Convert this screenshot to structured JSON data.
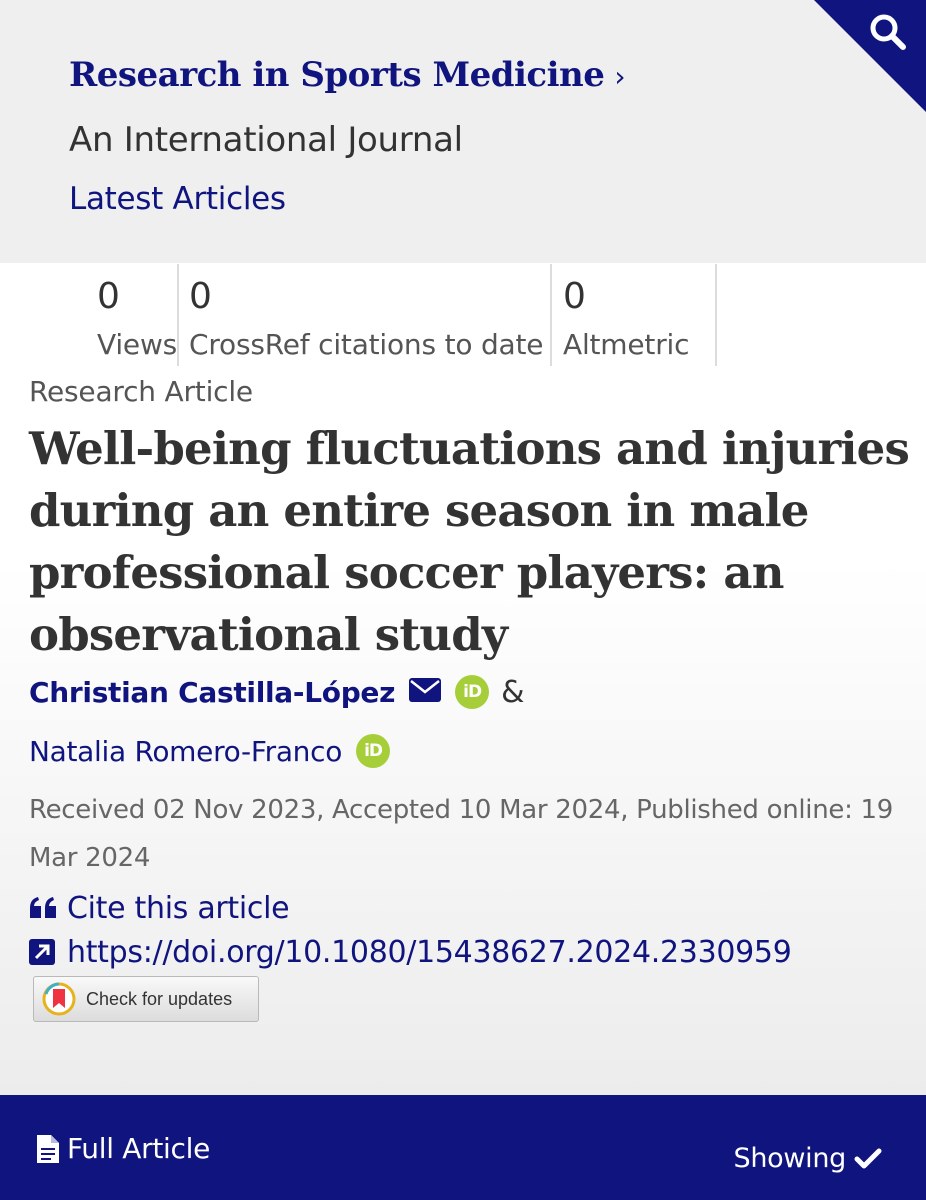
{
  "header": {
    "journal_title": "Research in Sports Medicine",
    "journal_subtitle": "An International Journal",
    "latest_link": "Latest Articles",
    "chevron": "›"
  },
  "metrics": [
    {
      "value": "0",
      "label": "Views"
    },
    {
      "value": "0",
      "label": "CrossRef citations to date"
    },
    {
      "value": "0",
      "label": "Altmetric"
    }
  ],
  "article": {
    "type": "Research Article",
    "title": "Well-being fluctuations and injuries during an entire season in male professional soccer players: an observational study",
    "authors": [
      {
        "name": "Christian Castilla-López",
        "orcid_badge": "iD"
      },
      {
        "name": "Natalia Romero-Franco",
        "orcid_badge": "iD"
      }
    ],
    "author_separator": "&",
    "dates": "Received 02 Nov 2023, Accepted 10 Mar 2024, Published online: 19 Mar 2024",
    "cite_label": "Cite this article",
    "doi": "https://doi.org/10.1080/15438627.2024.2330959",
    "check_updates_label": "Check for updates"
  },
  "bottom_bar": {
    "full_article_label": "Full Article",
    "showing_label": "Showing"
  },
  "colors": {
    "brand_navy": "#10147e",
    "orcid_green": "#a6ce39",
    "header_bg": "#efefef"
  },
  "icons": [
    "search-icon",
    "mail-icon",
    "orcid-icon",
    "quote-icon",
    "external-link-icon",
    "crossmark-icon",
    "document-icon",
    "checkmark-icon"
  ]
}
